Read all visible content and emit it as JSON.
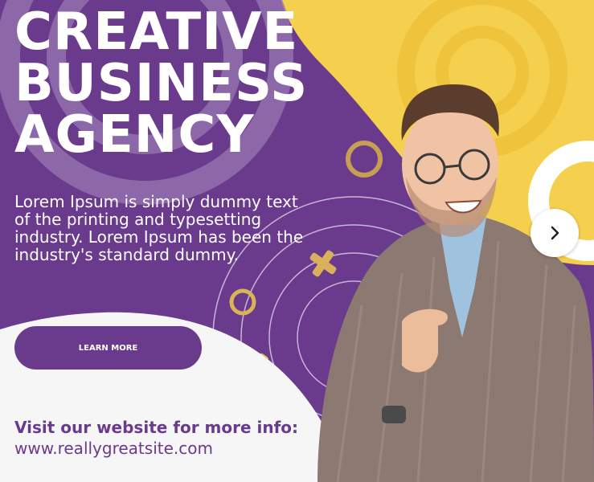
{
  "headline": {
    "line1": "CREATIVE",
    "line2": "BUSINESS",
    "line3": "AGENCY"
  },
  "body": {
    "text": "Lorem Ipsum is simply dummy text of the printing and typesetting industry. Lorem Ipsum has been the industry's standard dummy."
  },
  "cta": {
    "label": "LEARN MORE"
  },
  "footer": {
    "visit_text": "Visit our website for more info:",
    "url": "www.reallygreatsite.com"
  },
  "carousel": {
    "next_icon": "chevron-right-icon"
  },
  "colors": {
    "purple": "#6a3a8c",
    "yellow": "#f5d04e",
    "white": "#ffffff"
  }
}
